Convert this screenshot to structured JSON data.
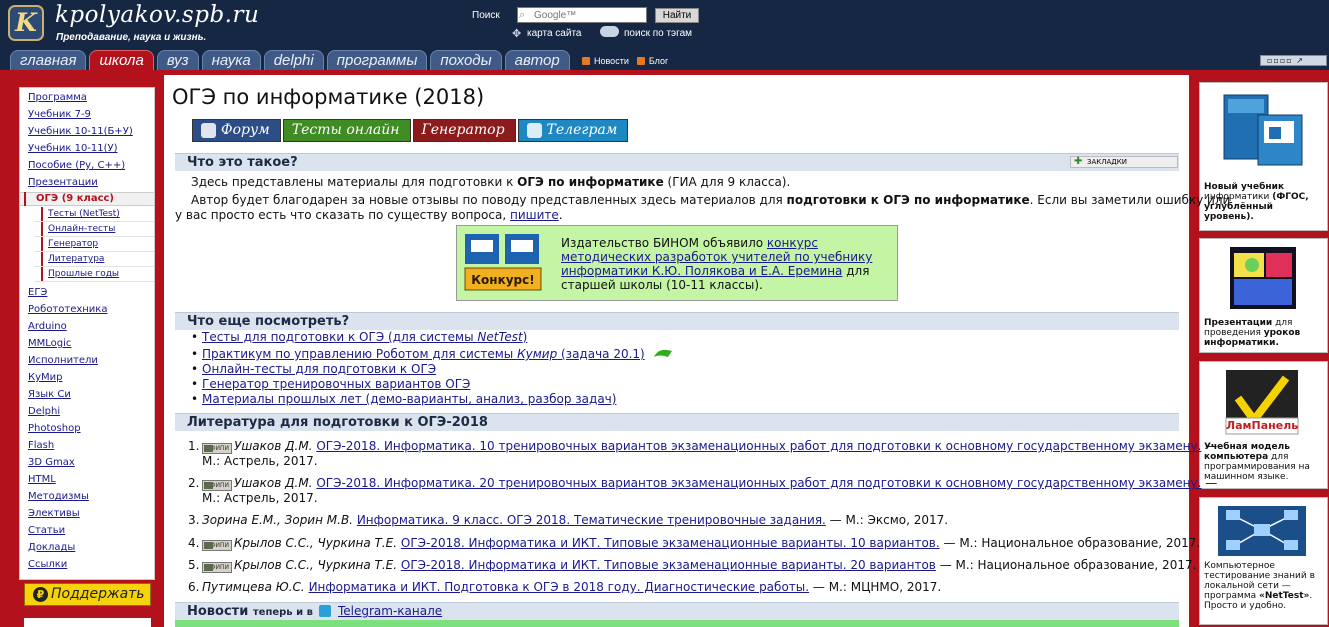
{
  "header": {
    "site_title": "kpolyakov.spb.ru",
    "tagline": "Преподавание, наука и жизнь.",
    "search_label": "Поиск",
    "search_placeholder": "Google™",
    "search_button": "Найти",
    "sitemap_link": "карта сайта",
    "tag_search_link": "поиск по тэгам",
    "tabs": [
      "главная",
      "школа",
      "вуз",
      "наука",
      "delphi",
      "программы",
      "походы",
      "автор"
    ],
    "news_link": "Новости",
    "blog_link": "Блог",
    "view_controls": "▫▫▫▫  ↗"
  },
  "left_menu": {
    "items_before": [
      "Программа",
      "Учебник 7-9",
      "Учебник 10-11(Б+У)",
      "Учебник 10-11(У)",
      "Пособие (Ру, С++)",
      "Презентации"
    ],
    "active_item": "ОГЭ (9 класс)",
    "sub_items": [
      "Тесты (NetTest)",
      "Онлайн-тесты",
      "Генератор",
      "Литература",
      "Прошлые годы"
    ],
    "items_after": [
      "ЕГЭ",
      "Робототехника",
      "Arduino",
      "MMLogic",
      "Исполнители",
      "КуМир",
      "Язык Си",
      "Delphi",
      "Photoshop",
      "Flash",
      "3D Gmax",
      "HTML",
      "Методизмы",
      "Элективы",
      "Статьи",
      "Доклады",
      "Ссылки"
    ],
    "donate_button": "Поддержать"
  },
  "right_sidebar": {
    "card1": {
      "bold": "Новый учебник",
      "text": "информатики",
      "bold2": "(ФГОС, углублённый уровень)."
    },
    "card2": {
      "bold": "Презентации",
      "text": "для проведения",
      "bold2": "уроков информатики."
    },
    "card3": {
      "logo": "ЛамПанель",
      "bold": "Учебная модель компьютера",
      "text": "для программирования на машинном языке."
    },
    "card4": {
      "text": "Компьютерное тестирование знаний в локальной сети — программа",
      "bold": "«NetTest»",
      "text2": ". Просто и удобно."
    }
  },
  "main": {
    "title": "ОГЭ по информатике (2018)",
    "buttons": [
      "Форум",
      "Тесты онлайн",
      "Генератор",
      "Телеграм"
    ],
    "section_what": "Что это такое?",
    "bookmarks": "ЗАКЛАДКИ",
    "intro_1_a": "Здесь представлены материалы для подготовки к ",
    "intro_1_b": "ОГЭ по информатике",
    "intro_1_c": " (ГИА для 9 класса).",
    "intro_2_a": "Автор будет благодарен за новые отзывы по поводу представленных здесь материалов для ",
    "intro_2_b": "подготовки к ОГЭ по информатике",
    "intro_2_c": ". Если вы заметили ошибку или",
    "intro_3_a": "у вас просто есть что сказать по существу вопроса, ",
    "intro_3_link": "пишите",
    "intro_3_c": ".",
    "contest": {
      "badge": "Конкурс!",
      "text_a": "Издательство БИНОМ объявило ",
      "link": "конкурс методических разработок учителей по учебнику информатики К.Ю. Полякова и Е.А. Еремина",
      "text_b": " для старшей школы (10-11 классы)."
    },
    "section_more": "Что еще посмотреть?",
    "more_links": [
      "Тесты для подготовки к ОГЭ (для системы ",
      "Практикум по управлению Роботом для системы ",
      "Онлайн-тесты для подготовки к ОГЭ",
      "Генератор тренировочных вариантов ОГЭ",
      "Материалы прошлых лет (демо-варианты, анализ, разбор задач)"
    ],
    "more_link_1_italic": "NetTest",
    "more_link_1_end": ")",
    "more_link_2_italic": "Кумир",
    "more_link_2_end": " (задача 20.1)",
    "section_lit": "Литература для подготовки к ОГЭ-2018",
    "fipi": "ФИПИ",
    "literature": [
      {
        "num": "1.",
        "author": "Ушаков Д.М.",
        "title": "ОГЭ-2018. Информатика. 10 тренировочных вариантов экзаменационных работ для подготовки к основному государственному экзамену.",
        "tail": " —",
        "line2": "М.: Астрель, 2017."
      },
      {
        "num": "2.",
        "author": "Ушаков Д.М.",
        "title": "ОГЭ-2018. Информатика. 20 тренировочных вариантов экзаменационных работ для подготовки к основному государственному экзамену.",
        "tail": " —",
        "line2": "М.: Астрель, 2017."
      },
      {
        "num": "3.",
        "author": "Зорина Е.М., Зорин М.В.",
        "title": "Информатика. 9 класс. ОГЭ 2018. Тематические тренировочные задания.",
        "tail": " — М.: Эксмо, 2017."
      },
      {
        "num": "4.",
        "author": "Крылов С.С., Чуркина Т.Е.",
        "title": "ОГЭ-2018. Информатика и ИКТ. Типовые экзаменационные варианты. 10 вариантов.",
        "tail": " — М.: Национальное образование, 2017."
      },
      {
        "num": "5.",
        "author": "Крылов С.С., Чуркина Т.Е.",
        "title": "ОГЭ-2018. Информатика и ИКТ. Типовые экзаменационные варианты. 20 вариантов",
        "tail": " — М.: Национальное образование, 2017."
      },
      {
        "num": "6.",
        "author": "Путимцева Ю.С.",
        "title": "Информатика и ИКТ. Подготовка к ОГЭ в 2018 году. Диагностические работы.",
        "tail": " — М.: МЦНМО, 2017."
      }
    ],
    "section_news": "Новости",
    "news_small": "теперь и в",
    "news_link": "Telegram-канале"
  }
}
